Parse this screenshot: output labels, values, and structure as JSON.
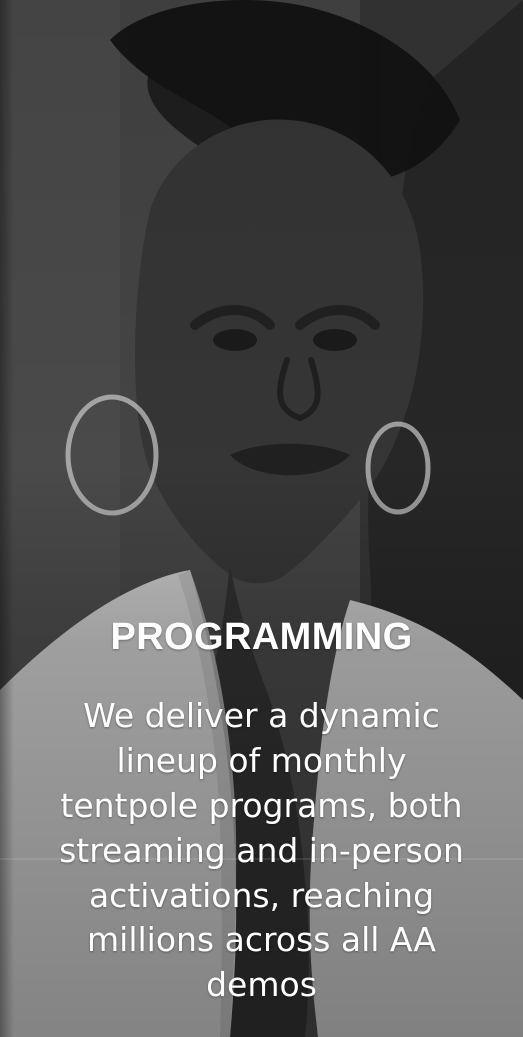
{
  "section": {
    "title": "PROGRAMMING",
    "description": "We deliver a dynamic lineup of monthly tentpole programs, both streaming and in-person activations, reaching millions across all AA demos"
  }
}
